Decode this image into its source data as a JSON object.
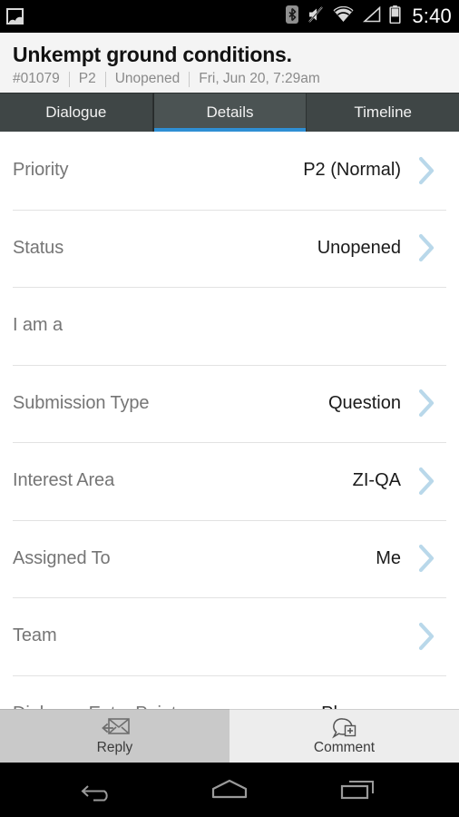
{
  "statusbar": {
    "notification_icon": "image-icon",
    "icons": [
      "bluetooth-icon",
      "volume-mute-icon",
      "wifi-icon",
      "cell-signal-icon",
      "battery-icon"
    ],
    "time": "5:40"
  },
  "header": {
    "title": "Unkempt ground conditions.",
    "meta": {
      "id": "#01079",
      "priority": "P2",
      "status": "Unopened",
      "timestamp": "Fri, Jun 20, 7:29am"
    }
  },
  "tabs": {
    "items": [
      {
        "label": "Dialogue",
        "active": false
      },
      {
        "label": "Details",
        "active": true
      },
      {
        "label": "Timeline",
        "active": false
      }
    ],
    "accent_color": "#2f8fd4"
  },
  "details": {
    "chevron_color": "#b9d8ea",
    "rows": [
      {
        "label": "Priority",
        "value": "P2 (Normal)",
        "chevron": true
      },
      {
        "label": "Status",
        "value": "Unopened",
        "chevron": true
      },
      {
        "label": "I am a",
        "value": "",
        "chevron": false
      },
      {
        "label": "Submission Type",
        "value": "Question",
        "chevron": true
      },
      {
        "label": "Interest Area",
        "value": "ZI-QA",
        "chevron": true
      },
      {
        "label": "Assigned To",
        "value": "Me",
        "chevron": true
      },
      {
        "label": "Team",
        "value": "",
        "chevron": true
      },
      {
        "label": "Dialogue Entry Point",
        "value": "Phone",
        "chevron": false
      }
    ]
  },
  "actionbar": {
    "reply": {
      "label": "Reply",
      "icon": "reply-envelope-icon",
      "pressed": true
    },
    "comment": {
      "label": "Comment",
      "icon": "comment-add-icon",
      "pressed": false
    }
  },
  "navbar": {
    "back": "back-icon",
    "home": "home-icon",
    "recents": "recents-icon"
  }
}
